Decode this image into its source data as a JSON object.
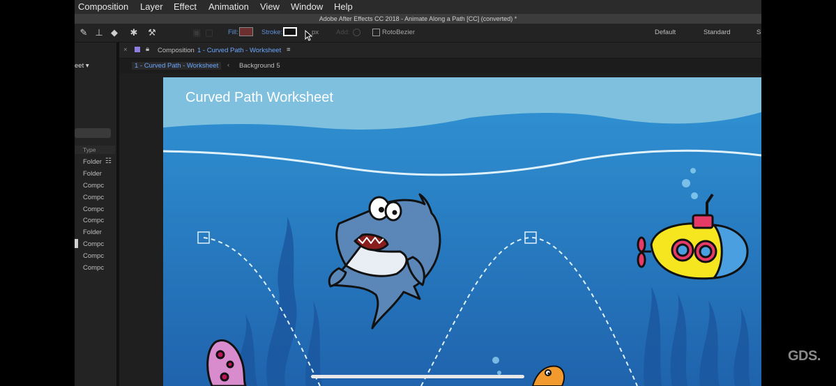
{
  "menu": [
    "Composition",
    "Layer",
    "Effect",
    "Animation",
    "View",
    "Window",
    "Help"
  ],
  "window_title": "Adobe After Effects CC 2018 - Animate Along a Path [CC] (converted) *",
  "toolbar": {
    "fill_label": "Fill:",
    "stroke_label": "Stroke:",
    "px_label": "px",
    "add_label": "Add:",
    "rotobezier_label": "RotoBezier",
    "workspaces": [
      "Default",
      "Standard",
      "S"
    ]
  },
  "left_panel": {
    "dropdown_fragment": "eet ▾",
    "column_type": "Type",
    "items": [
      "Folder",
      "Folder",
      "Compc",
      "Compc",
      "Compc",
      "Compc",
      "Folder",
      "Compc",
      "Compc",
      "Compc"
    ]
  },
  "comp_panel": {
    "tab_prefix": "Composition",
    "tab_name": "1 - Curved Path - Worksheet",
    "breadcrumb_active": "1 - Curved Path - Worksheet",
    "breadcrumb_next": "Background 5"
  },
  "viewer": {
    "title": "Curved Path Worksheet"
  },
  "watermark": "GDS.",
  "colors": {
    "accent_blue": "#6aa6ff",
    "ocean_top": "#7fc0de",
    "ocean_deep": "#1f63ad",
    "submarine": "#f5e61f",
    "shark": "#5a87b8"
  }
}
